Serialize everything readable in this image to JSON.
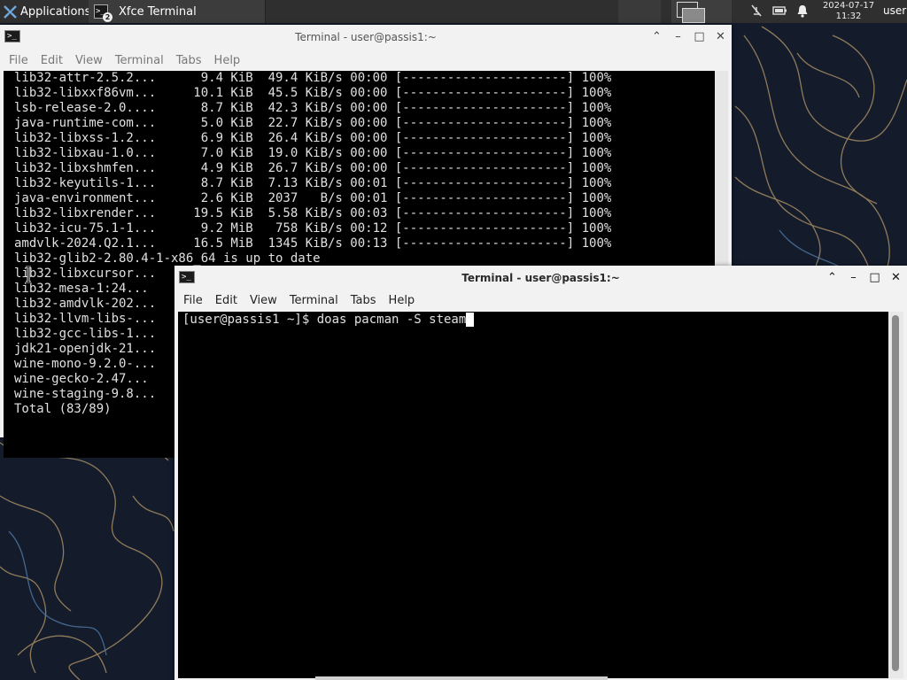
{
  "panel": {
    "applications_label": "Applications",
    "task_label": "Xfce Terminal",
    "task_badge": "2",
    "clock_date": "2024-07-17",
    "clock_time": "11:32",
    "user_label": "user"
  },
  "window1": {
    "title": "Terminal - user@passis1:~",
    "menu": [
      "File",
      "Edit",
      "View",
      "Terminal",
      "Tabs",
      "Help"
    ],
    "lines": [
      "lib32-attr-2.5.2...      9.4 KiB  49.4 KiB/s 00:00 [----------------------] 100%",
      "lib32-libxxf86vm...     10.1 KiB  45.5 KiB/s 00:00 [----------------------] 100%",
      "lsb-release-2.0....      8.7 KiB  42.3 KiB/s 00:00 [----------------------] 100%",
      "java-runtime-com...      5.0 KiB  22.7 KiB/s 00:00 [----------------------] 100%",
      "lib32-libxss-1.2...      6.9 KiB  26.4 KiB/s 00:00 [----------------------] 100%",
      "lib32-libxau-1.0...      7.0 KiB  19.0 KiB/s 00:00 [----------------------] 100%",
      "lib32-libxshmfen...      4.9 KiB  26.7 KiB/s 00:00 [----------------------] 100%",
      "lib32-keyutils-1...      8.7 KiB  7.13 KiB/s 00:01 [----------------------] 100%",
      "java-environment...      2.6 KiB  2037   B/s 00:01 [----------------------] 100%",
      "lib32-libxrender...     19.5 KiB  5.58 KiB/s 00:03 [----------------------] 100%",
      "lib32-icu-75.1-1...      9.2 MiB   758 KiB/s 00:12 [----------------------] 100%",
      "amdvlk-2024.Q2.1...     16.5 MiB  1345 KiB/s 00:13 [----------------------] 100%",
      "lib32-glib2-2.80.4-1-x86_64 is up to date",
      "lib32-libxcursor...",
      "lib32-mesa-1:24...",
      "lib32-amdvlk-202...",
      "lib32-llvm-libs-...",
      "lib32-gcc-libs-1...",
      "jdk21-openjdk-21...",
      "wine-mono-9.2.0-...",
      "wine-gecko-2.47...",
      "wine-staging-9.8...",
      "Total (83/89)"
    ]
  },
  "window2": {
    "title": "Terminal - user@passis1:~",
    "menu": [
      "File",
      "Edit",
      "View",
      "Terminal",
      "Tabs",
      "Help"
    ],
    "prompt": "[user@passis1 ~]$ ",
    "command": "doas pacman -S steam"
  },
  "icons": {
    "applications": "xfce-logo-icon",
    "terminal": "terminal-icon",
    "workspace": "workspace-switcher-icon",
    "notifications_off": "notification-off-icon",
    "battery": "battery-icon",
    "bell": "bell-icon"
  },
  "colors": {
    "panel_bg": "#2f2f2f",
    "window_bg": "#f2f2f2",
    "terminal_bg": "#000000",
    "terminal_fg": "#e0e0e0",
    "wallpaper_bg": "#141c2c",
    "wallpaper_line": "#b89a6a"
  }
}
